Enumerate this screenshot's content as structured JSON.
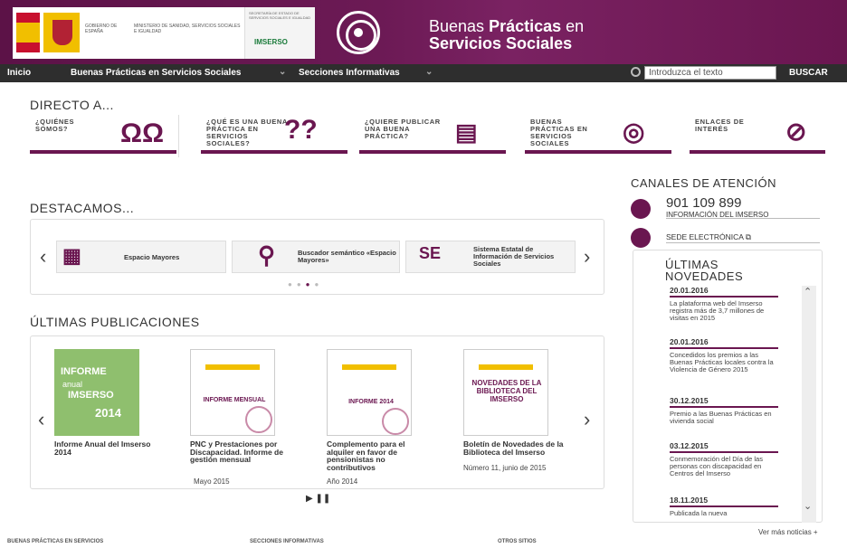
{
  "banner": {
    "gov": "GOBIERNO DE ESPAÑA",
    "ministry": "MINISTERIO DE SANIDAD, SERVICIOS SOCIALES E IGUALDAD",
    "sec": "SECRETARÍA DE ESTADO DE SERVICIOS SOCIALES E IGUALDAD",
    "imserso": "IMSERSO",
    "title1": "Buenas ",
    "title1b": "Prácticas",
    "title1c": " en",
    "title2": "Servicios Sociales"
  },
  "nav": {
    "inicio": "Inicio",
    "buenas": "Buenas Prácticas en Servicios Sociales",
    "secciones": "Secciones Informativas",
    "search_placeholder": "Introduzca el texto",
    "search_btn": "BUSCAR"
  },
  "directo": {
    "heading": "DIRECTO A...",
    "cards": [
      {
        "label": "¿QUIÉNES SOMOS?"
      },
      {
        "label": "¿QUÉ ES UNA BUENA PRÁCTICA EN SERVICIOS SOCIALES?"
      },
      {
        "label": "¿QUIERE PUBLICAR UNA BUENA PRÁCTICA?"
      },
      {
        "label": "BUENAS PRÁCTICAS EN SERVICIOS SOCIALES"
      },
      {
        "label": "ENLACES DE INTERÉS"
      }
    ]
  },
  "destacamos": {
    "heading": "DESTACAMOS...",
    "items": [
      {
        "label": "Espacio Mayores"
      },
      {
        "label": "Buscador semántico «Espacio Mayores»"
      },
      {
        "label": "Sistema Estatal de Información de Servicios Sociales"
      }
    ]
  },
  "publicaciones": {
    "heading": "ÚLTIMAS PUBLICACIONES",
    "items": [
      {
        "title": "Informe Anual del Imserso 2014",
        "sub": ""
      },
      {
        "title": "PNC y Prestaciones por Discapacidad. Informe de gestión mensual",
        "sub": "Mayo 2015"
      },
      {
        "title": "Complemento para el alquiler en favor de pensionistas no contributivos",
        "sub": "Año 2014"
      },
      {
        "title": "Boletín de Novedades de la Biblioteca del Imserso",
        "sub": "Número 11, junio de 2015"
      }
    ],
    "cover1": {
      "a": "INFORME",
      "b": "anual",
      "c": "IMSERSO",
      "d": "2014"
    },
    "cover2": "INFORME MENSUAL",
    "cover3": "INFORME 2014",
    "cover4": "NOVEDADES DE LA BIBLIOTECA DEL IMSERSO"
  },
  "canales": {
    "heading": "CANALES DE ATENCIÓN",
    "phone": "901 109 899",
    "phone_sub": "INFORMACIÓN DEL IMSERSO",
    "sede": "SEDE ELECTRÓNICA"
  },
  "novedades": {
    "heading1": "ÚLTIMAS",
    "heading2": "NOVEDADES",
    "items": [
      {
        "date": "20.01.2016",
        "text": "La plataforma web del Imserso registra más de 3,7 millones de visitas en 2015"
      },
      {
        "date": "20.01.2016",
        "text": "Concedidos los premios a las Buenas Prácticas locales contra la Violencia de Género 2015"
      },
      {
        "date": "30.12.2015",
        "text": "Premio a las Buenas Prácticas en vivienda social"
      },
      {
        "date": "03.12.2015",
        "text": "Conmemoración del Día de las personas con discapacidad en Centros del Imserso"
      },
      {
        "date": "18.11.2015",
        "text": "Publicada la nueva"
      }
    ],
    "more": "Ver más noticias +"
  },
  "footer": {
    "a": "BUENAS PRÁCTICAS EN SERVICIOS",
    "b": "SECCIONES INFORMATIVAS",
    "c": "OTROS SITIOS"
  }
}
